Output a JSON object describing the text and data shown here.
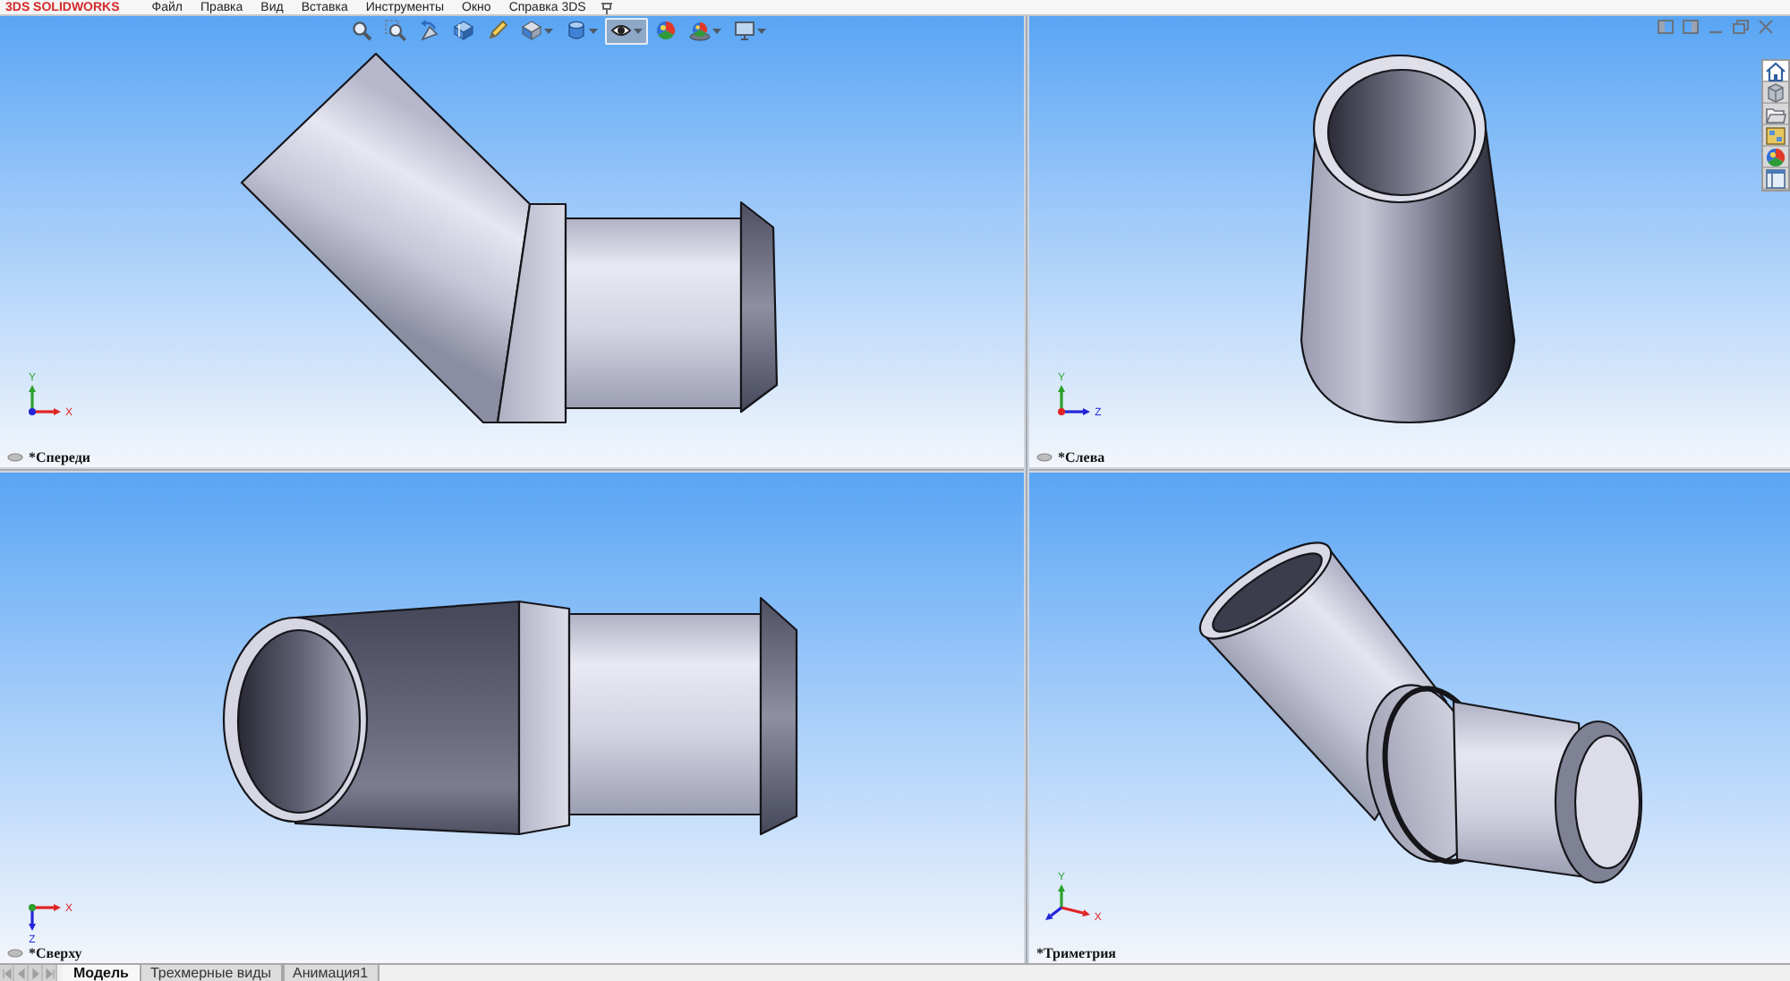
{
  "menu_bar": {
    "title": "3DS SOLIDWORKS",
    "items": [
      "Файл",
      "Правка",
      "Вид",
      "Вставка",
      "Инструменты",
      "Окно",
      "Справка 3DS"
    ]
  },
  "view_toolbar": [
    {
      "kind": "zoomfit",
      "dropdown": false,
      "selected": false
    },
    {
      "kind": "zoomarea",
      "dropdown": false,
      "selected": false
    },
    {
      "kind": "previous",
      "dropdown": false,
      "selected": false
    },
    {
      "kind": "section",
      "dropdown": false,
      "selected": false
    },
    {
      "kind": "annotation",
      "dropdown": false,
      "selected": false
    },
    {
      "kind": "orientation",
      "dropdown": true,
      "selected": false
    },
    {
      "kind": "display",
      "dropdown": true,
      "selected": false
    },
    {
      "kind": "hideshow",
      "dropdown": true,
      "selected": true
    },
    {
      "kind": "appearance",
      "dropdown": false,
      "selected": false
    },
    {
      "kind": "scene",
      "dropdown": true,
      "selected": false
    },
    {
      "kind": "settings",
      "dropdown": true,
      "selected": false
    }
  ],
  "viewports": [
    {
      "kind": "front",
      "axes": [
        {
          "label": "Y",
          "kind": "north",
          "color": "#2ca02c"
        },
        {
          "label": "X",
          "kind": "east",
          "color": "#e02424"
        },
        {
          "kind": "dot",
          "color": "#2424d8"
        }
      ],
      "toggle_icon": true,
      "label": "*Спереди"
    },
    {
      "kind": "top",
      "axes": [
        {
          "label": "X",
          "kind": "east",
          "color": "#e02424"
        },
        {
          "label": "Z",
          "kind": "south",
          "color": "#2424d8"
        },
        {
          "kind": "dot",
          "color": "#2ca02c"
        }
      ],
      "toggle_icon": true,
      "label": "*Сверху"
    },
    {
      "kind": "left",
      "axes": [
        {
          "label": "Y",
          "kind": "north",
          "color": "#2ca02c"
        },
        {
          "label": "Z",
          "kind": "east",
          "color": "#2424d8"
        },
        {
          "kind": "dot",
          "color": "#e02424"
        }
      ],
      "toggle_icon": true,
      "label": "*Слева"
    },
    {
      "kind": "trimetric",
      "axes": [
        {
          "label": "Y",
          "kind": "northshort",
          "color": "#2ca02c"
        },
        {
          "label": "X",
          "kind": "southeast",
          "color": "#e02424"
        },
        {
          "kind": "southwest",
          "color": "#2424d8"
        }
      ],
      "toggle_icon": false,
      "label": "*Триметрия"
    }
  ],
  "task_pane_tabs": [
    {
      "kind": "home",
      "selected": true
    },
    {
      "kind": "parts",
      "selected": false
    },
    {
      "kind": "files",
      "selected": false
    },
    {
      "kind": "views",
      "selected": false
    },
    {
      "kind": "appearances",
      "selected": false
    },
    {
      "kind": "properties",
      "selected": false
    }
  ],
  "bottom_tabs": [
    {
      "label": "Модель",
      "selected": true
    },
    {
      "label": "Трехмерные виды",
      "selected": false
    },
    {
      "label": "Анимация1",
      "selected": false
    }
  ]
}
